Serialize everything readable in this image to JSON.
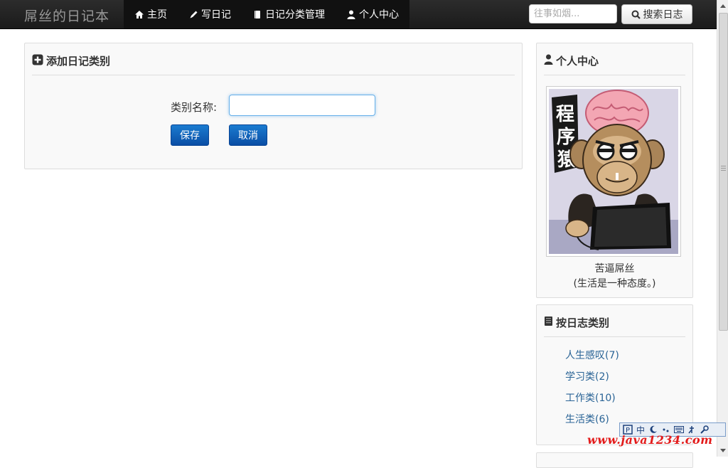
{
  "navbar": {
    "brand": "屌丝的日记本",
    "items": [
      {
        "label": "主页",
        "icon": "home-icon"
      },
      {
        "label": "写日记",
        "icon": "pencil-icon"
      },
      {
        "label": "日记分类管理",
        "icon": "book-icon"
      },
      {
        "label": "个人中心",
        "icon": "user-icon"
      }
    ],
    "search_placeholder": "往事如烟...",
    "search_button": "搜索日志"
  },
  "main": {
    "title": "添加日记类别",
    "title_icon": "plus-square-icon",
    "field_label": "类别名称:",
    "field_value": "",
    "save_label": "保存",
    "cancel_label": "取消"
  },
  "profile": {
    "title": "个人中心",
    "title_icon": "user-icon",
    "avatar_caption": "程序猿",
    "name": "苦逼屌丝",
    "motto": "(生活是一种态度。)"
  },
  "categories": {
    "title": "按日志类别",
    "title_icon": "notebook-icon",
    "items": [
      {
        "label": "人生感叹(7)"
      },
      {
        "label": "学习类(2)"
      },
      {
        "label": "工作类(10)"
      },
      {
        "label": "生活类(6)"
      }
    ]
  },
  "ime": {
    "mode": "中"
  },
  "watermark": "www.java1234.com",
  "colors": {
    "navbar_bg": "#222222",
    "button_blue": "#0a5bbd",
    "link": "#2a6496",
    "watermark": "#e31b1b"
  }
}
